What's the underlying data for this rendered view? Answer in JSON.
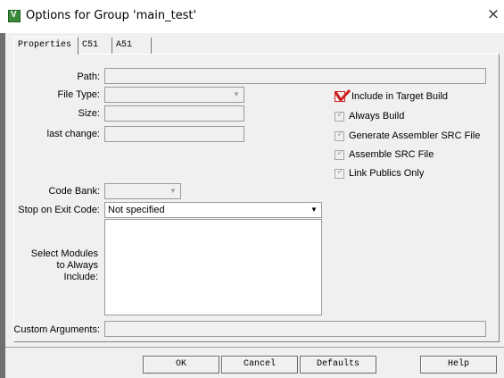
{
  "window": {
    "title": "Options for Group 'main_test'",
    "close_label": "×",
    "app_icon_glyph": "V"
  },
  "tabs": [
    {
      "label": "Properties",
      "active": true
    },
    {
      "label": "C51",
      "active": false
    },
    {
      "label": "A51",
      "active": false
    }
  ],
  "properties": {
    "path_label": "Path:",
    "path_value": "",
    "file_type_label": "File Type:",
    "file_type_value": "",
    "size_label": "Size:",
    "size_value": "",
    "last_change_label": "last change:",
    "last_change_value": "",
    "code_bank_label": "Code Bank:",
    "code_bank_value": "",
    "stop_on_exit_label": "Stop on Exit Code:",
    "stop_on_exit_value": "Not specified",
    "select_modules_label_line1": "Select Modules",
    "select_modules_label_line2": "to Always",
    "select_modules_label_line3": "Include:",
    "custom_args_label": "Custom Arguments:",
    "custom_args_value": ""
  },
  "options": {
    "include_in_build": {
      "label": "Include in Target Build",
      "checked": true,
      "enabled": true
    },
    "always_build": {
      "label": "Always Build",
      "checked": true,
      "enabled": false
    },
    "generate_src": {
      "label": "Generate Assembler SRC File",
      "checked": true,
      "enabled": false
    },
    "assemble_src": {
      "label": "Assemble SRC File",
      "checked": true,
      "enabled": false
    },
    "link_publics": {
      "label": "Link Publics Only",
      "checked": true,
      "enabled": false
    }
  },
  "buttons": {
    "ok": "OK",
    "cancel": "Cancel",
    "defaults": "Defaults",
    "help": "Help"
  },
  "colors": {
    "check_red": "#cc1f1f",
    "app_icon_green": "#3a8a3a"
  }
}
